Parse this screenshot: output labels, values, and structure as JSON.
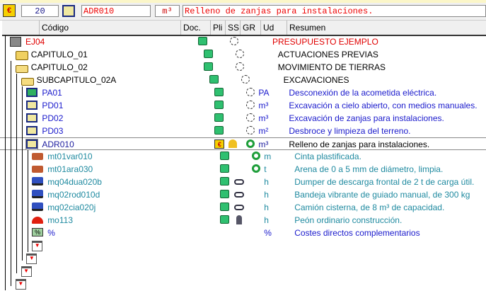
{
  "toolbar": {
    "quantity": "20",
    "code": "ADR010",
    "unit": "m³",
    "summary": "Relleno de zanjas para instalaciones."
  },
  "header": {
    "codigo": "Código",
    "doc": "Doc.",
    "pli": "Pli",
    "ss": "SS",
    "gr": "GR",
    "ud": "Ud",
    "resumen": "Resumen"
  },
  "colors": {
    "red": "#ff0000",
    "blue": "#1a1acc",
    "teal": "#1f8aa0",
    "green": "#1e9e3a"
  },
  "rows": [
    {
      "level": 0,
      "icon": "budget-icon",
      "code": "EJ04",
      "ud": "",
      "summary": "PRESUPUESTO EJEMPLO",
      "color": "#e00000",
      "pli": true,
      "gr": "gear"
    },
    {
      "level": 1,
      "icon": "folder-icon",
      "code": "CAPITULO_01",
      "ud": "",
      "summary": "ACTUACIONES PREVIAS",
      "color": "#000",
      "pli": true,
      "gr": "gear"
    },
    {
      "level": 1,
      "icon": "folder-open-icon",
      "code": "CAPITULO_02",
      "ud": "",
      "summary": "MOVIMIENTO DE TIERRAS",
      "color": "#000",
      "pli": true,
      "gr": "gear"
    },
    {
      "level": 2,
      "icon": "folder-open-icon",
      "code": "SUBCAPITULO_02A",
      "ud": "",
      "summary": "EXCAVACIONES",
      "color": "#000",
      "pli": true,
      "gr": "gear"
    },
    {
      "level": 3,
      "icon": "item-green-icon",
      "code": "PA01",
      "ud": "PA",
      "summary": "Desconexión de la acometida eléctrica.",
      "color": "#1a1acc",
      "pli": true,
      "gr": "gear"
    },
    {
      "level": 3,
      "icon": "item-icon",
      "code": "PD01",
      "ud": "m³",
      "summary": "Excavación a cielo abierto, con medios manuales.",
      "color": "#1a1acc",
      "pli": true,
      "gr": "gear"
    },
    {
      "level": 3,
      "icon": "item-icon",
      "code": "PD02",
      "ud": "m³",
      "summary": "Excavación de zanjas para instalaciones.",
      "color": "#1a1acc",
      "pli": true,
      "gr": "gear"
    },
    {
      "level": 3,
      "icon": "item-icon",
      "code": "PD03",
      "ud": "m²",
      "summary": "Desbroce y limpieza del terreno.",
      "color": "#1a1acc",
      "pli": true,
      "gr": "gear"
    },
    {
      "level": 3,
      "icon": "item-selected-icon",
      "code": "ADR010",
      "ud": "m³",
      "summary": "Relleno de zanjas para instalaciones.",
      "color": "#2020a0",
      "sumcolor": "#000",
      "pli": "euro",
      "ss": "cone",
      "gr": "recycle",
      "selected": true
    },
    {
      "level": 4,
      "icon": "brick-icon",
      "code": "mt01var010",
      "ud": "m",
      "summary": "Cinta plastificada.",
      "color": "#1f8aa0",
      "pli": true,
      "gr": "recycle"
    },
    {
      "level": 4,
      "icon": "brick-icon",
      "code": "mt01ara030",
      "ud": "t",
      "summary": "Arena de 0 a 5 mm de diámetro, limpia.",
      "color": "#1f8aa0",
      "pli": true,
      "gr": "recycle"
    },
    {
      "level": 4,
      "icon": "truck-icon",
      "code": "mq04dua020b",
      "ud": "h",
      "summary": "Dumper de descarga frontal de 2 t de carga útil.",
      "color": "#1f8aa0",
      "pli": true,
      "ss": "goggles"
    },
    {
      "level": 4,
      "icon": "truck-icon",
      "code": "mq02rod010d",
      "ud": "h",
      "summary": "Bandeja vibrante de guiado manual, de 300 kg",
      "color": "#1f8aa0",
      "pli": true,
      "ss": "goggles"
    },
    {
      "level": 4,
      "icon": "truck-icon",
      "code": "mq02cia020j",
      "ud": "h",
      "summary": "Camión cisterna, de 8 m³ de capacidad.",
      "color": "#1f8aa0",
      "pli": true,
      "ss": "goggles"
    },
    {
      "level": 4,
      "icon": "helmet-icon",
      "code": "mo113",
      "ud": "h",
      "summary": "Peón ordinario construcción.",
      "color": "#1f8aa0",
      "pli": true,
      "ss": "worker"
    },
    {
      "level": 4,
      "icon": "percent-icon",
      "code": "%",
      "ud": "%",
      "summary": "Costes directos complementarios",
      "color": "#1a1acc"
    },
    {
      "level": 4,
      "icon": "end-marker-icon",
      "code": "",
      "ud": "",
      "summary": ""
    },
    {
      "level": 3,
      "icon": "end-marker-icon",
      "code": "",
      "ud": "",
      "summary": ""
    },
    {
      "level": 2,
      "icon": "end-marker-icon",
      "code": "",
      "ud": "",
      "summary": ""
    },
    {
      "level": 1,
      "icon": "end-marker-icon",
      "code": "",
      "ud": "",
      "summary": ""
    }
  ]
}
